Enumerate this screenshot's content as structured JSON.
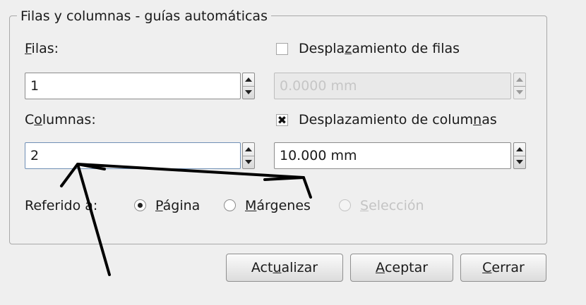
{
  "group": {
    "title": "Filas y columnas - guías automáticas"
  },
  "rows": {
    "label_pre": "",
    "label_mn": "F",
    "label_post": "ilas:",
    "value": "1",
    "offset_checked": false,
    "offset_label_pre": "Despla",
    "offset_label_mn": "z",
    "offset_label_post": "amiento de filas",
    "offset_value": "0.0000 mm"
  },
  "columns": {
    "label_pre": "C",
    "label_mn": "o",
    "label_post": "lumnas:",
    "value": "2",
    "offset_checked": true,
    "offset_mark": "✖",
    "offset_label_pre": "Desplazamiento de colum",
    "offset_label_mn": "n",
    "offset_label_post": "as",
    "offset_value": "10.000 mm"
  },
  "reference": {
    "label": "Referido a:",
    "options": [
      {
        "pre": "",
        "mn": "P",
        "post": "ágina",
        "selected": true,
        "enabled": true
      },
      {
        "pre": "",
        "mn": "M",
        "post": "árgenes",
        "selected": false,
        "enabled": true
      },
      {
        "pre": "",
        "mn": "S",
        "post": "elección",
        "selected": false,
        "enabled": false
      }
    ]
  },
  "buttons": {
    "update": {
      "pre": "Act",
      "mn": "u",
      "post": "alizar"
    },
    "accept": {
      "pre": "",
      "mn": "A",
      "post": "ceptar"
    },
    "close": {
      "pre": "",
      "mn": "C",
      "post": "errar"
    }
  },
  "colors": {
    "background": "#efefef",
    "annotation_arrows": "#000000"
  }
}
